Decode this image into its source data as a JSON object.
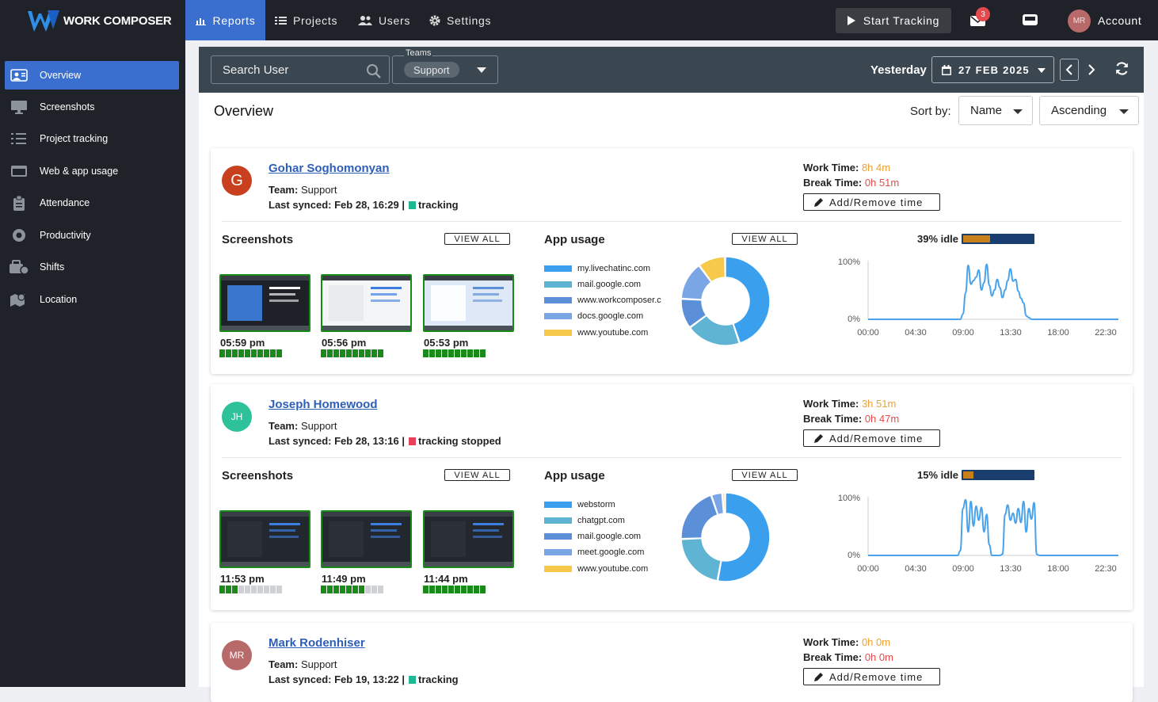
{
  "app": {
    "name": "WORK COMPOSER"
  },
  "topnav": {
    "items": [
      {
        "label": "Reports",
        "icon": "bar-chart-icon",
        "active": true
      },
      {
        "label": "Projects",
        "icon": "list-icon"
      },
      {
        "label": "Users",
        "icon": "users-icon"
      },
      {
        "label": "Settings",
        "icon": "gear-icon"
      }
    ],
    "start_tracking": "Start Tracking",
    "mail_badge": "3",
    "account_initials": "MR",
    "account_label": "Account"
  },
  "sidebar": {
    "items": [
      {
        "label": "Overview",
        "icon": "overview-icon",
        "active": true
      },
      {
        "label": "Screenshots",
        "icon": "monitor-icon"
      },
      {
        "label": "Project tracking",
        "icon": "checklist-icon"
      },
      {
        "label": "Web & app usage",
        "icon": "browser-icon"
      },
      {
        "label": "Attendance",
        "icon": "clipboard-icon"
      },
      {
        "label": "Productivity",
        "icon": "gauge-icon"
      },
      {
        "label": "Shifts",
        "icon": "shifts-icon"
      },
      {
        "label": "Location",
        "icon": "map-icon"
      }
    ]
  },
  "filter": {
    "search_placeholder": "Search User",
    "teams_label": "Teams",
    "team_chip": "Support",
    "period": "Yesterday",
    "date": "27 FEB 2025"
  },
  "overview": {
    "title": "Overview",
    "sort_label": "Sort by:",
    "sort_field": "Name",
    "sort_order": "Ascending"
  },
  "labels": {
    "team_prefix": "Team:",
    "synced_prefix": "Last synced:",
    "work_time": "Work Time:",
    "break_time": "Break Time:",
    "add_remove": "Add/Remove time",
    "screenshots": "Screenshots",
    "app_usage": "App usage",
    "view_all": "VIEW ALL",
    "y_top": "100%",
    "y_bottom": "0%",
    "x_ticks": [
      "00:00",
      "04:30",
      "09:00",
      "13:30",
      "18:00",
      "22:30"
    ]
  },
  "colors": {
    "accent": "#3a6fd0",
    "tracking": "#1fb894",
    "stopped": "#e8405a",
    "work_time": "#f0a030",
    "break_time": "#e84b4b",
    "line": "#4aa3ea"
  },
  "users": [
    {
      "name": "Gohar Soghomonyan",
      "initials": "G",
      "avatar_color": "#c8401e",
      "team": "Support",
      "synced": "Feb 28, 16:29 |",
      "status": "tracking",
      "status_color": "#1fb894",
      "work_time": "8h 4m",
      "break_time": "0h 51m",
      "screenshots": [
        {
          "time": "05:59 pm",
          "activity": 10
        },
        {
          "time": "05:56 pm",
          "activity": 10
        },
        {
          "time": "05:53 pm",
          "activity": 10
        }
      ],
      "app_usage": [
        {
          "name": "my.livechatinc.com",
          "color": "#3aa0ee",
          "share": 45
        },
        {
          "name": "mail.google.com",
          "color": "#5fb4d4",
          "share": 20
        },
        {
          "name": "www.workcomposer.c",
          "color": "#5b8fd8",
          "share": 11
        },
        {
          "name": "docs.google.com",
          "color": "#7aa6e6",
          "share": 14
        },
        {
          "name": "www.youtube.com",
          "color": "#f6c94a",
          "share": 10
        }
      ],
      "idle": "39% idle",
      "idle_fraction": 0.39,
      "activity_series": [
        0,
        0,
        0,
        0,
        0,
        0,
        0,
        0,
        0,
        0,
        0,
        0,
        0,
        0,
        0,
        0,
        0,
        0,
        0,
        0,
        0,
        0,
        0,
        0,
        0,
        0,
        0,
        0,
        0,
        0,
        0,
        0,
        0,
        0,
        0,
        0,
        9,
        45,
        92,
        60,
        66,
        72,
        84,
        50,
        62,
        94,
        58,
        40,
        50,
        68,
        54,
        37,
        50,
        66,
        86,
        65,
        68,
        48,
        36,
        28,
        6,
        3,
        0,
        0,
        0,
        0,
        0,
        0,
        0,
        0,
        0,
        0,
        0,
        0,
        0,
        0,
        0,
        0,
        0,
        0,
        0,
        0,
        0,
        0,
        0,
        0,
        0,
        0,
        0,
        0,
        0,
        0,
        0,
        0,
        0,
        0
      ]
    },
    {
      "name": "Joseph Homewood",
      "initials": "JH",
      "avatar_color": "#2ec29a",
      "team": "Support",
      "synced": "Feb 28, 13:16 |",
      "status": "tracking stopped",
      "status_color": "#e8405a",
      "work_time": "3h 51m",
      "break_time": "0h 47m",
      "screenshots": [
        {
          "time": "11:53 pm",
          "activity": 3
        },
        {
          "time": "11:49 pm",
          "activity": 7
        },
        {
          "time": "11:44 pm",
          "activity": 10
        }
      ],
      "app_usage": [
        {
          "name": "webstorm",
          "color": "#3aa0ee",
          "share": 52
        },
        {
          "name": "chatgpt.com",
          "color": "#5fb4d4",
          "share": 21
        },
        {
          "name": "mail.google.com",
          "color": "#5b8fd8",
          "share": 20
        },
        {
          "name": "meet.google.com",
          "color": "#7aa6e6",
          "share": 4
        },
        {
          "name": "www.youtube.com",
          "color": "#f6c94a",
          "share": 1
        }
      ],
      "idle": "15% idle",
      "idle_fraction": 0.15,
      "activity_series": [
        0,
        0,
        0,
        0,
        0,
        0,
        0,
        0,
        0,
        0,
        0,
        0,
        0,
        0,
        0,
        0,
        0,
        0,
        0,
        0,
        0,
        0,
        0,
        0,
        0,
        0,
        0,
        0,
        0,
        0,
        0,
        0,
        0,
        0,
        0,
        8,
        80,
        95,
        40,
        92,
        50,
        84,
        60,
        82,
        40,
        70,
        18,
        0,
        0,
        0,
        0,
        2,
        70,
        86,
        60,
        72,
        55,
        80,
        56,
        92,
        40,
        80,
        62,
        90,
        2,
        0,
        0,
        0,
        0,
        0,
        0,
        0,
        0,
        0,
        0,
        0,
        0,
        0,
        0,
        0,
        0,
        0,
        0,
        0,
        0,
        0,
        0,
        0,
        0,
        0,
        0,
        0,
        0,
        0,
        0,
        0
      ]
    },
    {
      "name": "Mark Rodenhiser",
      "initials": "MR",
      "avatar_color": "#b86a6a",
      "team": "Support",
      "synced": "Feb 19, 13:22 |",
      "status": "tracking",
      "status_color": "#1fb894",
      "work_time": "0h 0m",
      "break_time": "0h 0m"
    }
  ]
}
